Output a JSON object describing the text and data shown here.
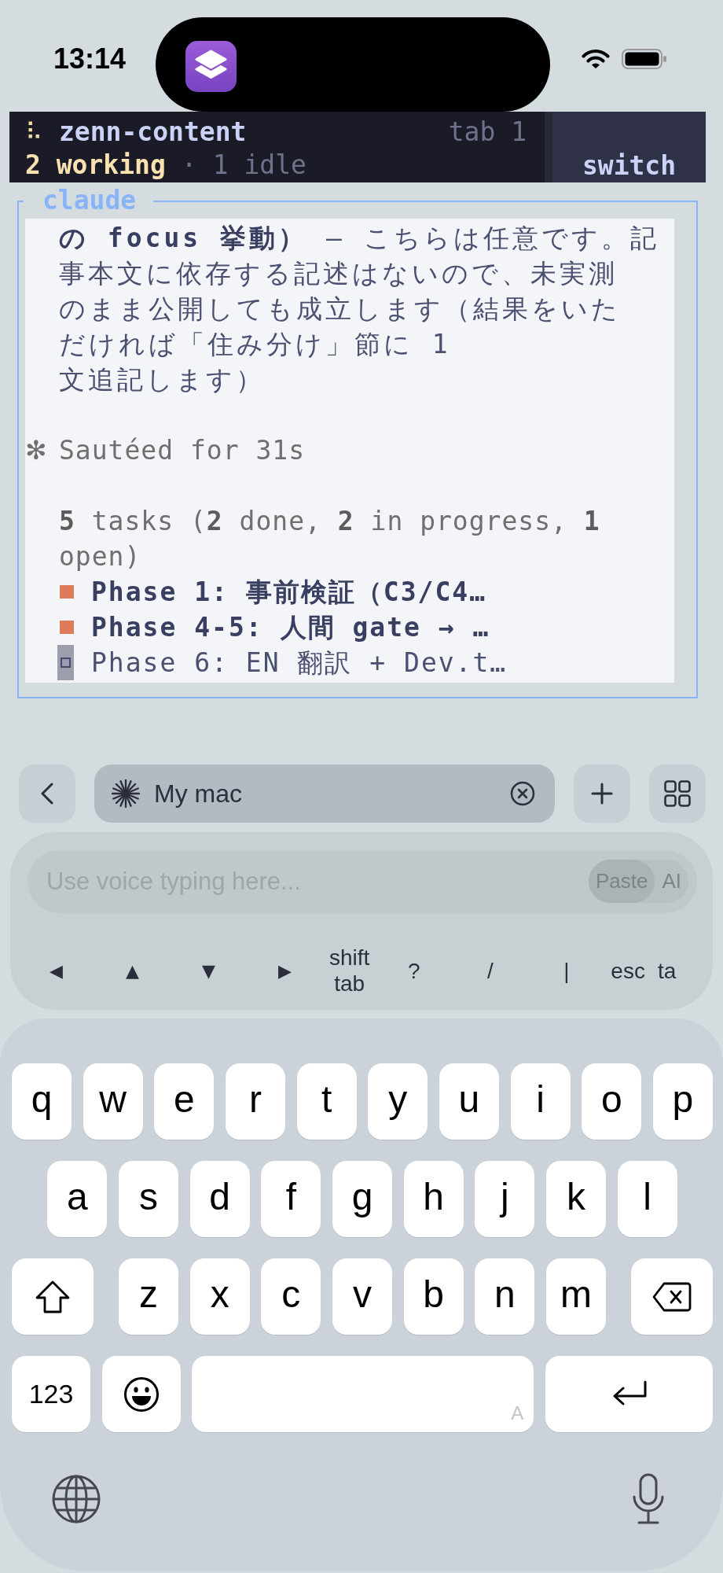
{
  "status_bar": {
    "time": "13:14"
  },
  "session_bar": {
    "spinner": "⠧",
    "name": "zenn-content",
    "tab": "tab 1",
    "working": "2 working",
    "separator": "·",
    "idle": "1 idle",
    "switch_button": "switch"
  },
  "pane": {
    "title": "claude",
    "blocks": [
      {
        "kind": "message",
        "lines": [
          "**の focus 挙動）** – こちらは任意です。記",
          "事本文に依存する記述はないので、未実測",
          "のまま公開しても成立します（結果をいた",
          "だければ「住み分け」節に 1",
          "文追記します）"
        ]
      },
      {
        "kind": "status",
        "glyph": "✻",
        "text": "Sautéed for 31s"
      },
      {
        "kind": "summary",
        "text": "**5** tasks (**2** done, **2** in progress, **1** open)"
      },
      {
        "kind": "task",
        "in_progress": true,
        "cursor": false,
        "text": "Phase 1: 事前検証（C3/C4…"
      },
      {
        "kind": "task",
        "in_progress": true,
        "cursor": false,
        "text": "Phase 4-5: 人間 gate → …"
      },
      {
        "kind": "task",
        "in_progress": false,
        "cursor": true,
        "text": "Phase 6: EN 翻訳 + Dev.t…"
      }
    ]
  },
  "toolbar": {
    "host": "My mac"
  },
  "voice_input": {
    "placeholder": "Use voice typing here...",
    "modes": [
      {
        "label": "Paste",
        "selected": true
      },
      {
        "label": "AI",
        "selected": false
      }
    ]
  },
  "shortcut_keys": [
    {
      "kind": "arrow",
      "label": "◀"
    },
    {
      "kind": "arrow",
      "label": "▲"
    },
    {
      "kind": "arrow",
      "label": "▼"
    },
    {
      "kind": "arrow",
      "label": "▶"
    },
    {
      "kind": "word",
      "label": "shift tab"
    },
    {
      "kind": "symbol",
      "label": "?"
    },
    {
      "kind": "symbol",
      "label": "/"
    },
    {
      "kind": "symbol",
      "label": "|"
    },
    {
      "kind": "word",
      "label": "esc"
    },
    {
      "kind": "word",
      "label": "ta"
    }
  ],
  "keyboard": {
    "letter_rows": [
      [
        "q",
        "w",
        "e",
        "r",
        "t",
        "y",
        "u",
        "i",
        "o",
        "p"
      ],
      [
        "a",
        "s",
        "d",
        "f",
        "g",
        "h",
        "j",
        "k",
        "l"
      ],
      [
        "z",
        "x",
        "c",
        "v",
        "b",
        "n",
        "m"
      ]
    ],
    "numbers_key": "123",
    "space_hint": "A"
  }
}
